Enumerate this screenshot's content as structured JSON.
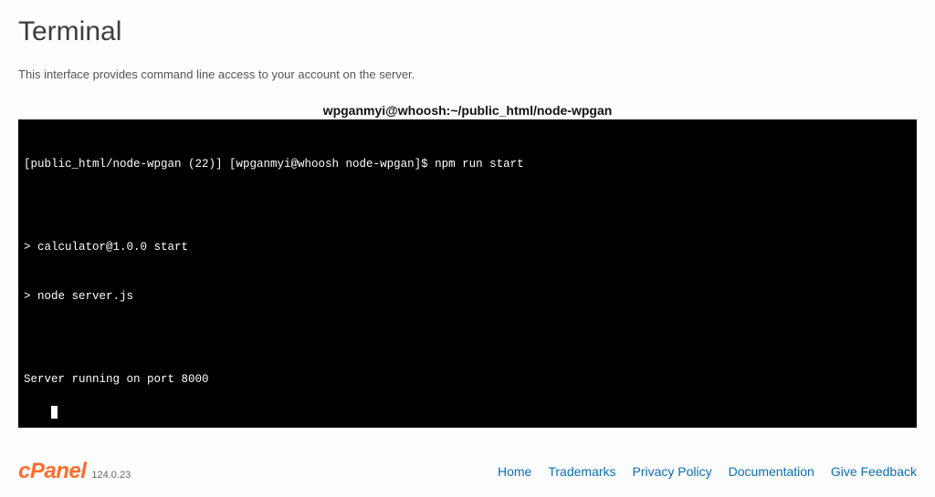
{
  "page": {
    "title": "Terminal",
    "description": "This interface provides command line access to your account on the server."
  },
  "terminal": {
    "session_title": "wpganmyi@whoosh:~/public_html/node-wpgan",
    "lines": [
      "[public_html/node-wpgan (22)] [wpganmyi@whoosh node-wpgan]$ npm run start",
      "",
      "> calculator@1.0.0 start",
      "> node server.js",
      "",
      "Server running on port 8000"
    ]
  },
  "footer": {
    "brand": "cPanel",
    "version": "124.0.23",
    "links": [
      {
        "label": "Home"
      },
      {
        "label": "Trademarks"
      },
      {
        "label": "Privacy Policy"
      },
      {
        "label": "Documentation"
      },
      {
        "label": "Give Feedback"
      }
    ]
  }
}
